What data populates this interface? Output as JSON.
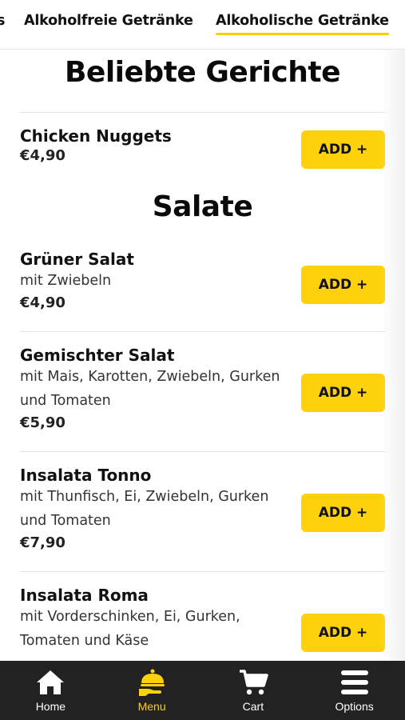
{
  "category_tabs": [
    "s",
    "Alkoholfreie Getränke",
    "Alkoholische Getränke"
  ],
  "active_tab_index": 2,
  "sections": [
    {
      "title": "Beliebte Gerichte",
      "items": [
        {
          "name": "Chicken Nuggets",
          "description": "",
          "price": "€4,90",
          "button": "ADD +"
        }
      ]
    },
    {
      "title": "Salate",
      "items": [
        {
          "name": "Grüner Salat",
          "description": "mit Zwiebeln",
          "price": "€4,90",
          "button": "ADD +"
        },
        {
          "name": "Gemischter Salat",
          "description": "mit Mais, Karotten, Zwiebeln, Gurken und Tomaten",
          "price": "€5,90",
          "button": "ADD +"
        },
        {
          "name": "Insalata Tonno",
          "description": "mit Thunfisch, Ei, Zwiebeln, Gurken und Tomaten",
          "price": "€7,90",
          "button": "ADD +"
        },
        {
          "name": "Insalata Roma",
          "description": "mit Vorderschinken, Ei, Gurken, Tomaten und Käse",
          "price": "",
          "button": "ADD +"
        }
      ]
    }
  ],
  "bottom_nav": [
    {
      "label": "Home",
      "icon": "home-icon"
    },
    {
      "label": "Menu",
      "icon": "waiter-icon"
    },
    {
      "label": "Cart",
      "icon": "cart-icon"
    },
    {
      "label": "Options",
      "icon": "menu-icon"
    }
  ],
  "active_nav_index": 1,
  "colors": {
    "accent": "#fdd20c",
    "nav_bg": "#222222"
  }
}
